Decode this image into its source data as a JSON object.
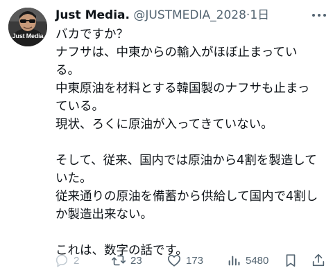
{
  "author": {
    "display_name": "Just Media.",
    "handle": "@JUSTMEDIA_2028",
    "separator": "·",
    "time": "1日",
    "avatar_text": "Just Media"
  },
  "body": {
    "lines": [
      "バカですか？",
      "ナフサは、中東からの輸入がほぼ止まってい",
      "る。",
      "中東原油を材料とする韓国製のナフサも止まっ",
      "ている。",
      "現状、ろくに原油が入ってきていない。",
      "",
      "そして、従来、国内では原油から4割を製造して",
      "いた。",
      "従来通りの原油を備蓄から供給して国内で4割し",
      "か製造出来ない。",
      "",
      "これは、数字の話です。"
    ]
  },
  "actions": {
    "reply_count": "2",
    "repost_count": "23",
    "like_count": "173",
    "view_count": "5480",
    "icons": [
      "reply-icon",
      "repost-icon",
      "like-icon",
      "views-icon",
      "bookmark-icon",
      "share-icon",
      "more-icon"
    ]
  },
  "colors": {
    "text": "#0f1419",
    "secondary": "#536471",
    "faint": "#aab4bd",
    "background": "#ffffff"
  }
}
